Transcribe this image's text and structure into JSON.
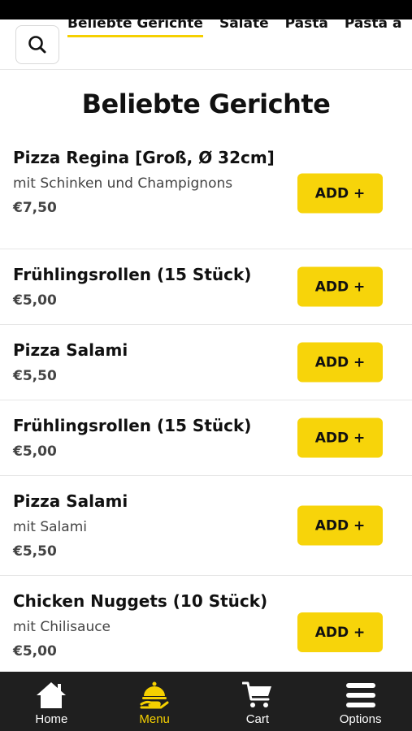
{
  "top_nav": {
    "tabs": [
      {
        "label": "Beliebte Gerichte",
        "active": true
      },
      {
        "label": "Salate",
        "active": false
      },
      {
        "label": "Pasta",
        "active": false
      },
      {
        "label": "Pasta a",
        "active": false
      }
    ],
    "search_icon": "search-icon"
  },
  "section": {
    "title": "Beliebte Gerichte"
  },
  "items": [
    {
      "name": "Pizza Regina [Groß, Ø 32cm]",
      "description": "mit Schinken und Champignons",
      "price": "€7,50",
      "button": "ADD +"
    },
    {
      "name": "Frühlingsrollen (15 Stück)",
      "description": "",
      "price": "€5,00",
      "button": "ADD +"
    },
    {
      "name": "Pizza Salami",
      "description": "",
      "price": "€5,50",
      "button": "ADD +"
    },
    {
      "name": "Frühlingsrollen (15 Stück)",
      "description": "",
      "price": "€5,00",
      "button": "ADD +"
    },
    {
      "name": "Pizza Salami",
      "description": "mit Salami",
      "price": "€5,50",
      "button": "ADD +"
    },
    {
      "name": "Chicken Nuggets (10 Stück)",
      "description": "mit Chilisauce",
      "price": "€5,00",
      "button": "ADD +"
    }
  ],
  "bottom_nav": {
    "items": [
      {
        "label": "Home",
        "icon": "home-icon",
        "active": false
      },
      {
        "label": "Menu",
        "icon": "serving-bell-icon",
        "active": true
      },
      {
        "label": "Cart",
        "icon": "cart-icon",
        "active": false
      },
      {
        "label": "Options",
        "icon": "hamburger-menu-icon",
        "active": false
      }
    ]
  },
  "colors": {
    "accent": "#f7d40a",
    "nav_bg": "#1f1f1f",
    "status_bar": "#000000"
  }
}
